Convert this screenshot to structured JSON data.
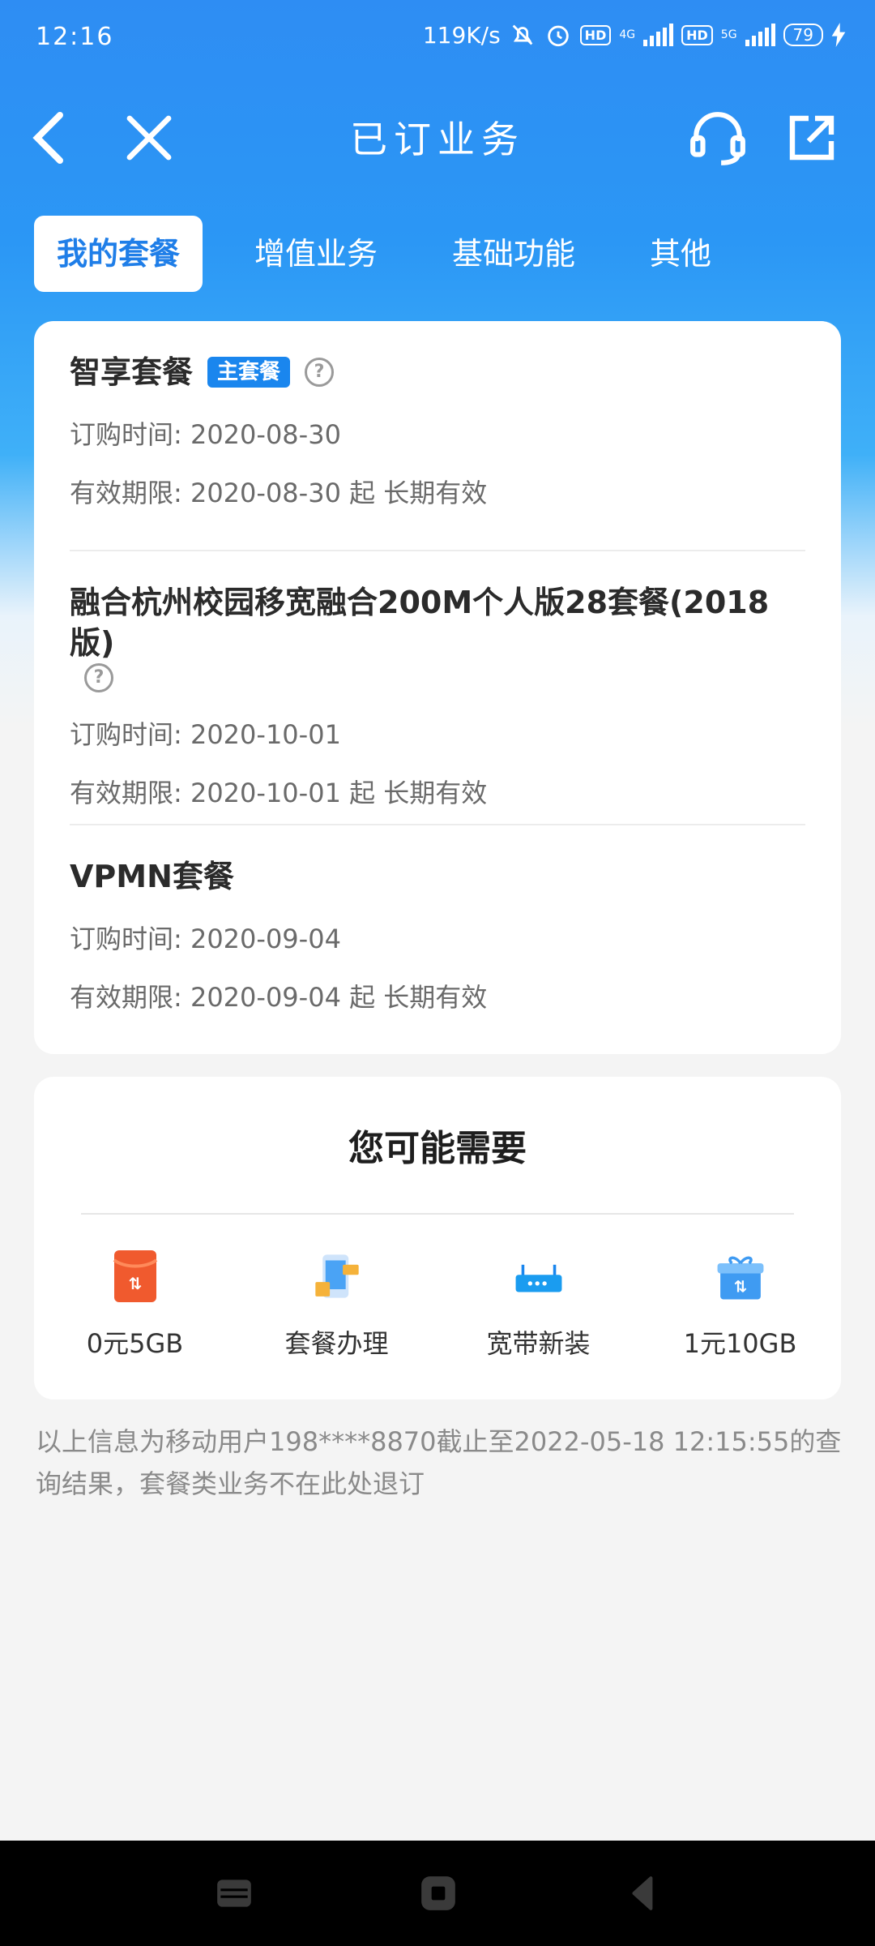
{
  "status_bar": {
    "time": "12:16",
    "speed": "119K/s",
    "hd1": "HD",
    "net1": "4G",
    "hd2": "HD",
    "net2": "5G",
    "battery": "79"
  },
  "nav": {
    "title": "已订业务"
  },
  "tabs": [
    {
      "label": "我的套餐",
      "active": true
    },
    {
      "label": "增值业务",
      "active": false
    },
    {
      "label": "基础功能",
      "active": false
    },
    {
      "label": "其他",
      "active": false
    }
  ],
  "packages": [
    {
      "name": "智享套餐",
      "badge": "主套餐",
      "order_time": "订购时间: 2020-08-30",
      "valid": "有效期限: 2020-08-30 起 长期有效"
    },
    {
      "name": "融合杭州校园移宽融合200M个人版28套餐(2018版)",
      "order_time": "订购时间: 2020-10-01",
      "valid": "有效期限: 2020-10-01 起 长期有效"
    },
    {
      "name": "VPMN套餐",
      "order_time": "订购时间: 2020-09-04",
      "valid": "有效期限: 2020-09-04 起 长期有效"
    }
  ],
  "recommend": {
    "title": "您可能需要",
    "items": [
      {
        "label": "0元5GB",
        "icon": "red-envelope-icon"
      },
      {
        "label": "套餐办理",
        "icon": "phone-plan-icon"
      },
      {
        "label": "宽带新装",
        "icon": "router-icon"
      },
      {
        "label": "1元10GB",
        "icon": "gift-box-icon"
      }
    ]
  },
  "footnote": "以上信息为移动用户198****8870截止至2022-05-18 12:15:55的查询结果，套餐类业务不在此处退订",
  "colors": {
    "primary": "#1f7ee8",
    "header_top": "#2e8df3",
    "background": "#f4f4f4"
  }
}
